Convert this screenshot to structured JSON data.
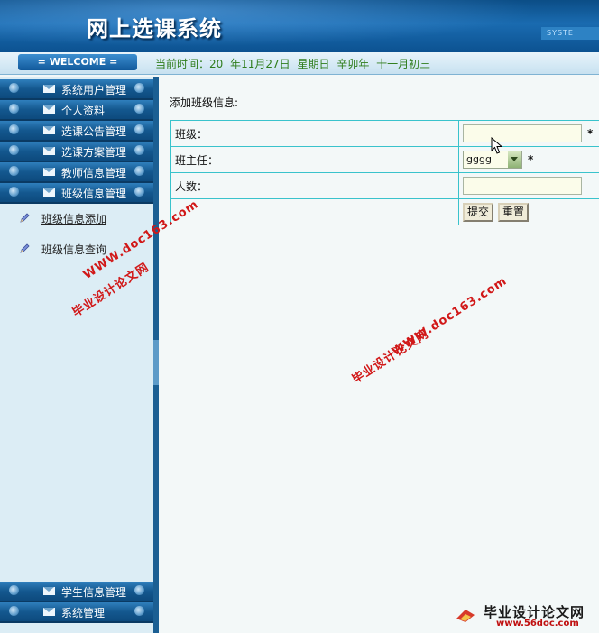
{
  "header": {
    "title": "网上选课系统",
    "system_label": "SYSTE"
  },
  "welcome": {
    "label": "= WELCOME ="
  },
  "time": {
    "prefix": "当前时间：20",
    "date": "年11月27日",
    "weekday": "星期日",
    "lunar_year": "辛卯年",
    "lunar_day": "十一月初三"
  },
  "sidebar": {
    "top_items": [
      {
        "label": "系统用户管理"
      },
      {
        "label": "个人资料"
      },
      {
        "label": "选课公告管理"
      },
      {
        "label": "选课方案管理"
      },
      {
        "label": "教师信息管理"
      },
      {
        "label": "班级信息管理"
      }
    ],
    "sub_items": [
      {
        "label": "班级信息添加"
      },
      {
        "label": "班级信息查询"
      }
    ],
    "bottom_items": [
      {
        "label": "学生信息管理"
      },
      {
        "label": "系统管理"
      }
    ]
  },
  "form": {
    "heading": "添加班级信息:",
    "class_label": "班级：",
    "head_teacher_label": "班主任：",
    "head_teacher_value": "gggg",
    "count_label": "人数：",
    "required_mark": "*",
    "submit_label": "提交",
    "reset_label": "重置"
  },
  "watermarks": {
    "site": "WWW.doc163.com",
    "name": "毕业设计论文网",
    "logo_name": "毕业设计论文网",
    "logo_url": "www.56doc.com"
  },
  "colors": {
    "header_bg": "#1a6bb0",
    "menu_bg": "#14588f",
    "time_text": "#2f7d1c",
    "table_border": "#39c3cc",
    "watermark": "#d11818"
  }
}
